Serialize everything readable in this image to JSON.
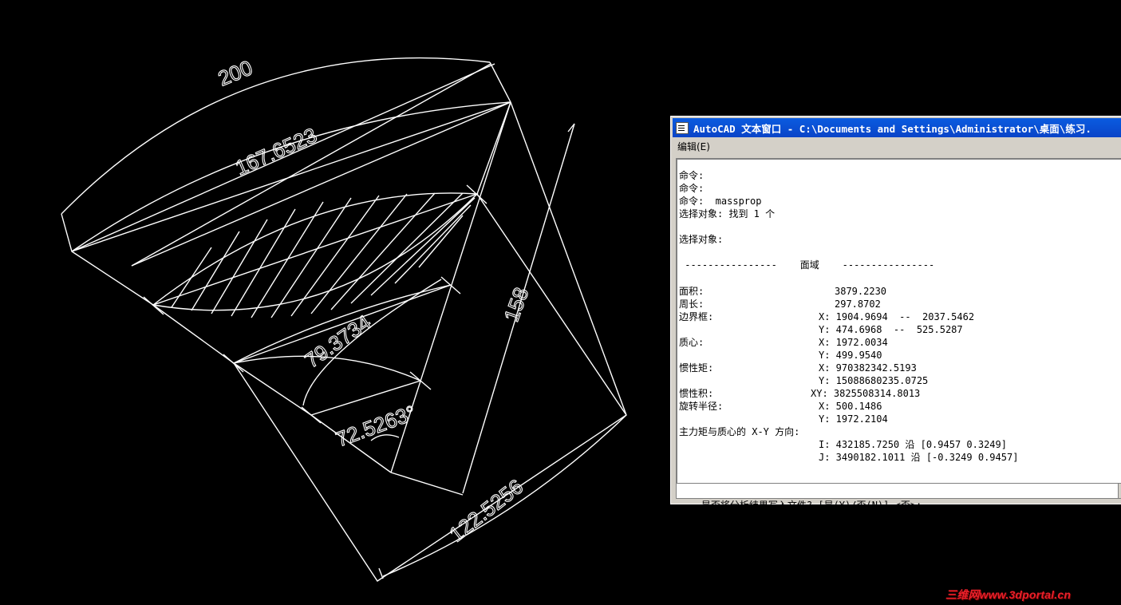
{
  "drawing": {
    "dims": {
      "arc_200": "200",
      "chord_167": "167.6523",
      "dim_158": "158",
      "arc_79": "79.3734",
      "angle_72": "72.5263°",
      "arc_122": "122.5256"
    }
  },
  "text_window": {
    "title": "AutoCAD 文本窗口 - C:\\Documents and Settings\\Administrator\\桌面\\练习.",
    "menu": [
      "编辑(E)"
    ],
    "lines": [
      {
        "label": "",
        "text": "命令:"
      },
      {
        "label": "",
        "text": "命令:"
      },
      {
        "label": "",
        "text": "命令:  massprop"
      },
      {
        "label": "",
        "text": "选择对象: 找到 1 个"
      },
      {
        "label": "",
        "text": ""
      },
      {
        "label": "",
        "text": "选择对象:"
      },
      {
        "label": "",
        "text": ""
      },
      {
        "label": "",
        "text": " ----------------    面域    ----------------"
      },
      {
        "label": "",
        "text": ""
      },
      {
        "label": "面积:",
        "text": "3879.2230"
      },
      {
        "label": "周长:",
        "text": "297.8702"
      },
      {
        "label": "边界框:",
        "text": "X: 1904.9694  --  2037.5462"
      },
      {
        "label": "",
        "text": "Y: 474.6968  --  525.5287"
      },
      {
        "label": "质心:",
        "text": "X: 1972.0034"
      },
      {
        "label": "",
        "text": "Y: 499.9540"
      },
      {
        "label": "惯性矩:",
        "text": "X: 970382342.5193"
      },
      {
        "label": "",
        "text": "Y: 15088680235.0725"
      },
      {
        "label": "惯性积:",
        "text": "XY: 3825508314.8013"
      },
      {
        "label": "旋转半径:",
        "text": "X: 500.1486"
      },
      {
        "label": "",
        "text": "Y: 1972.2104"
      },
      {
        "label": "主力矩与质心的 X-Y 方向:",
        "text": ""
      },
      {
        "label": "",
        "text": "I: 432185.7250 沿 [0.9457 0.3249]"
      },
      {
        "label": "",
        "text": "J: 3490182.1011 沿 [-0.3249 0.9457]"
      }
    ],
    "command_prompt": "是否将分析结果写入文件? [是(Y)/否(N)] <否>:"
  },
  "watermark": "三维网www.3dportal.cn"
}
